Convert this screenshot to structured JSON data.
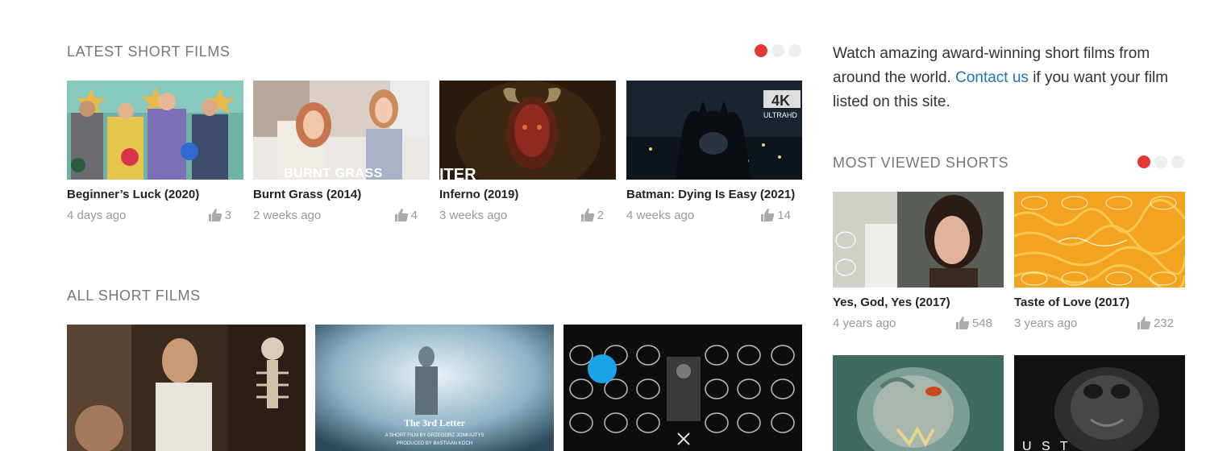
{
  "latest": {
    "title": "LATEST SHORT FILMS",
    "films": [
      {
        "title": "Beginner’s Luck (2020)",
        "age": "4 days ago",
        "likes": "3"
      },
      {
        "title": "Burnt Grass (2014)",
        "age": "2 weeks ago",
        "likes": "4"
      },
      {
        "title": "Inferno (2019)",
        "age": "3 weeks ago",
        "likes": "2"
      },
      {
        "title": "Batman: Dying Is Easy (2021)",
        "age": "4 weeks ago",
        "likes": "14"
      }
    ],
    "thumb_texts": {
      "burnt": "BURNT GRASS",
      "inferno": "ITER",
      "badge_4k": "4K",
      "badge_ultra": "ULTRAHD"
    }
  },
  "all": {
    "title": "ALL SHORT FILMS",
    "poster_texts": {
      "third_letter": "The 3rd Letter",
      "by": "A SHORT FILM BY GRZEGORZ JONKAJTYS",
      "produced": "PRODUCED BY BASTIAAN KOCH"
    }
  },
  "sidebar": {
    "intro_before": "Watch amazing award-winning short films from around the world. ",
    "intro_link": "Contact us",
    "intro_after": " if you want your film listed on this site.",
    "most_viewed_title": "MOST VIEWED SHORTS",
    "films": [
      {
        "title": "Yes, God, Yes (2017)",
        "age": "4 years ago",
        "likes": "548"
      },
      {
        "title": "Taste of Love (2017)",
        "age": "3 years ago",
        "likes": "232"
      }
    ],
    "poster_text_ust": "U S T"
  },
  "colors": {
    "accent_red": "#e53935",
    "link_blue": "#1e73be"
  }
}
